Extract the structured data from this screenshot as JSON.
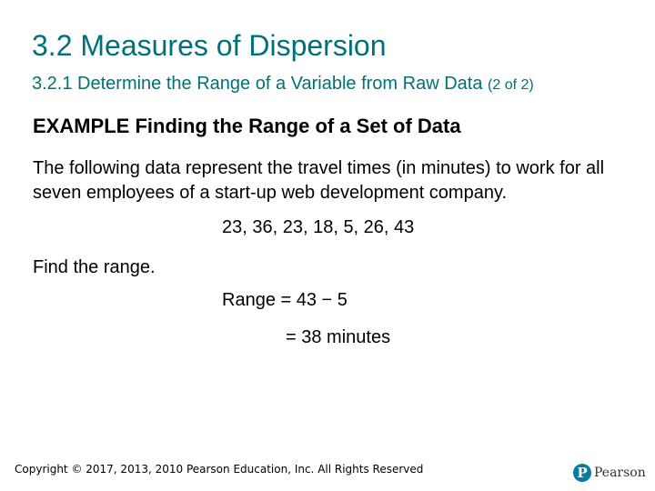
{
  "slide": {
    "title": "3.2 Measures of Dispersion",
    "subtitle": "3.2.1 Determine the Range of a Variable from Raw Data",
    "subtitle_part": "(2 of 2)",
    "example_heading": "EXAMPLE Finding the Range of a Set of Data",
    "paragraph": "The following data represent the travel times (in minutes) to work for all seven employees of a start-up web development company.",
    "dataset": "23, 36, 23, 18, 5, 26, 43",
    "prompt": "Find the range.",
    "equation_line1": "Range = 43 − 5",
    "equation_line2": "= 38 minutes"
  },
  "footer": {
    "copyright": "Copyright © 2017, 2013, 2010 Pearson Education, Inc. All Rights Reserved",
    "logo_mark": "P",
    "logo_text": "Pearson",
    "logo_icon": "pearson-logo-icon"
  },
  "colors": {
    "title": "#007079",
    "brand": "#007fa3"
  }
}
